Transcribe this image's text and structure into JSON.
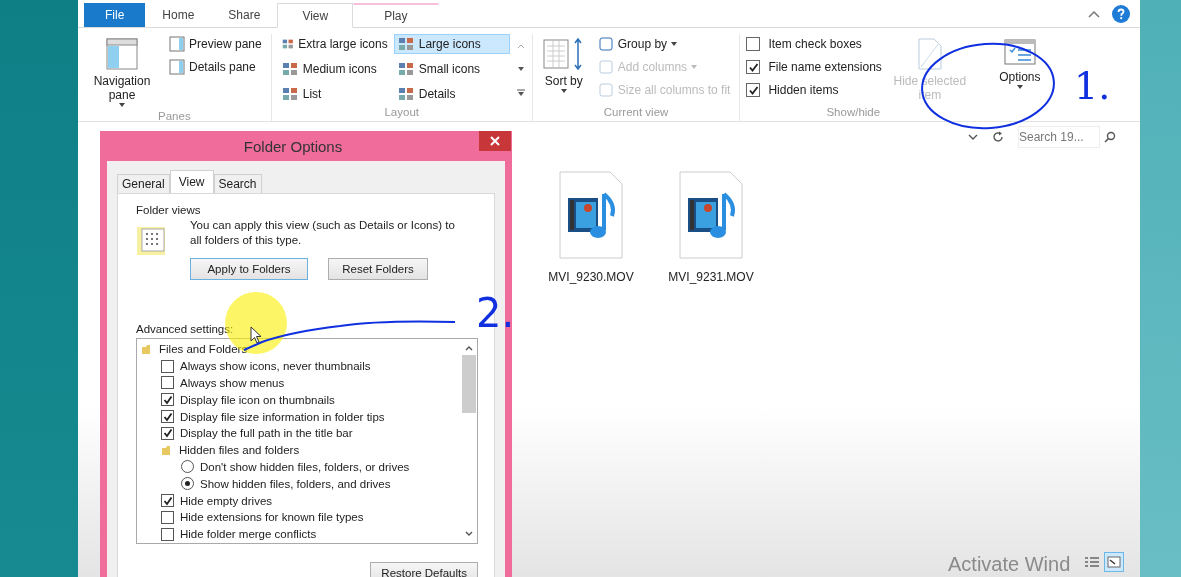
{
  "ribbon": {
    "tabs": [
      {
        "label": "File",
        "kind": "file",
        "selected": false
      },
      {
        "label": "Home",
        "kind": "normal",
        "selected": false
      },
      {
        "label": "Share",
        "kind": "normal",
        "selected": false
      },
      {
        "label": "View",
        "kind": "normal",
        "selected": true
      },
      {
        "label": "Play",
        "kind": "contextual",
        "selected": false
      }
    ],
    "panes": {
      "navigation_pane": "Navigation pane",
      "items": [
        "Preview pane",
        "Details pane"
      ],
      "label": "Panes"
    },
    "layout": {
      "items": [
        {
          "label": "Extra large icons",
          "selected": false
        },
        {
          "label": "Large icons",
          "selected": true
        },
        {
          "label": "Medium icons",
          "selected": false
        },
        {
          "label": "Small icons",
          "selected": false
        },
        {
          "label": "List",
          "selected": false
        },
        {
          "label": "Details",
          "selected": false
        }
      ],
      "label": "Layout"
    },
    "current_view": {
      "sort_by": "Sort by",
      "items": [
        {
          "label": "Group by",
          "disabled": false
        },
        {
          "label": "Add columns",
          "disabled": true
        },
        {
          "label": "Size all columns to fit",
          "disabled": true
        }
      ],
      "label": "Current view"
    },
    "show_hide": {
      "checkboxes": [
        {
          "label": "Item check boxes",
          "checked": false
        },
        {
          "label": "File name extensions",
          "checked": true
        },
        {
          "label": "Hidden items",
          "checked": true
        }
      ],
      "hide_selected": "Hide selected item",
      "options": "Options",
      "label": "Show/hide"
    }
  },
  "search": {
    "placeholder": "Search 19..."
  },
  "files": [
    {
      "name": "MVI_9230.MOV"
    },
    {
      "name": "MVI_9231.MOV"
    }
  ],
  "dialog": {
    "title": "Folder Options",
    "tabs": [
      {
        "label": "General",
        "selected": false
      },
      {
        "label": "View",
        "selected": true
      },
      {
        "label": "Search",
        "selected": false
      }
    ],
    "folder_views": {
      "heading": "Folder views",
      "text": "You can apply this view (such as Details or Icons) to all folders of this type.",
      "buttons": [
        "Apply to Folders",
        "Reset Folders"
      ]
    },
    "advanced_label": "Advanced settings:",
    "advanced": [
      {
        "kind": "folder",
        "label": "Files and Folders",
        "children": [
          {
            "kind": "checkbox",
            "label": "Always show icons, never thumbnails",
            "checked": false
          },
          {
            "kind": "checkbox",
            "label": "Always show menus",
            "checked": false
          },
          {
            "kind": "checkbox",
            "label": "Display file icon on thumbnails",
            "checked": true
          },
          {
            "kind": "checkbox",
            "label": "Display file size information in folder tips",
            "checked": true
          },
          {
            "kind": "checkbox",
            "label": "Display the full path in the title bar",
            "checked": true
          },
          {
            "kind": "folder",
            "label": "Hidden files and folders",
            "children": [
              {
                "kind": "radio",
                "label": "Don't show hidden files, folders, or drives",
                "selected": false
              },
              {
                "kind": "radio",
                "label": "Show hidden files, folders, and drives",
                "selected": true
              }
            ]
          },
          {
            "kind": "checkbox",
            "label": "Hide empty drives",
            "checked": true
          },
          {
            "kind": "checkbox",
            "label": "Hide extensions for known file types",
            "checked": false
          },
          {
            "kind": "checkbox",
            "label": "Hide folder merge conflicts",
            "checked": false
          }
        ]
      }
    ],
    "restore": "Restore Defaults"
  },
  "view_buttons": [
    {
      "kind": "details",
      "selected": false
    },
    {
      "kind": "large",
      "selected": true
    }
  ],
  "activation": "Activate Wind",
  "annotations": [
    "1.",
    "2."
  ]
}
